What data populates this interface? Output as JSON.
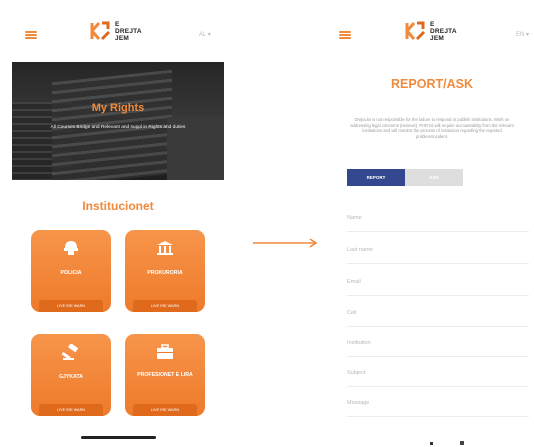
{
  "brand": {
    "logo_line1": "E",
    "logo_line2": "DREJTA",
    "logo_line3": "JEM",
    "color": "#f08a3c",
    "dark": "#34488f"
  },
  "left_screen": {
    "lang": "AL ▾",
    "hero": {
      "title": "My Rights",
      "subtitle": "All Courses Bridge and Relevant and suppl in Rights and duties",
      "slide_count": 3,
      "active_slide": 1
    },
    "section_title": "Institucionet",
    "cards": [
      {
        "label": "POLICIA",
        "button": "LIVE IRE WARN",
        "icon": "police-helmet-icon"
      },
      {
        "label": "PROKURORIA",
        "button": "LIVE IRE WARN",
        "icon": "court-building-icon"
      },
      {
        "label": "GJYKATA",
        "button": "LIVE IRE WARN",
        "icon": "gavel-icon"
      },
      {
        "label": "PROFESIONET E LIRA",
        "button": "LIVE IRE WARN",
        "icon": "briefcase-icon"
      }
    ]
  },
  "arrow_icon": "right-arrow-icon",
  "right_screen": {
    "lang": "EN ▾",
    "title": "REPORT/ASK",
    "description": "Drejta.ks is not responsible for the failure to respond or publish institutions. Work on addressing legal concerns (reviews). PHR ks will require accountability from the relevant institutions and will monitor the process of resolution regarding the reported problem/incident.",
    "tabs": {
      "report": "REPORT",
      "ask": "ASK"
    },
    "fields": [
      {
        "placeholder": "Name"
      },
      {
        "placeholder": "Last name"
      },
      {
        "placeholder": "Email"
      },
      {
        "placeholder": "Cell"
      },
      {
        "placeholder": "Institution"
      },
      {
        "placeholder": "Subject"
      },
      {
        "placeholder": "Message"
      }
    ]
  }
}
